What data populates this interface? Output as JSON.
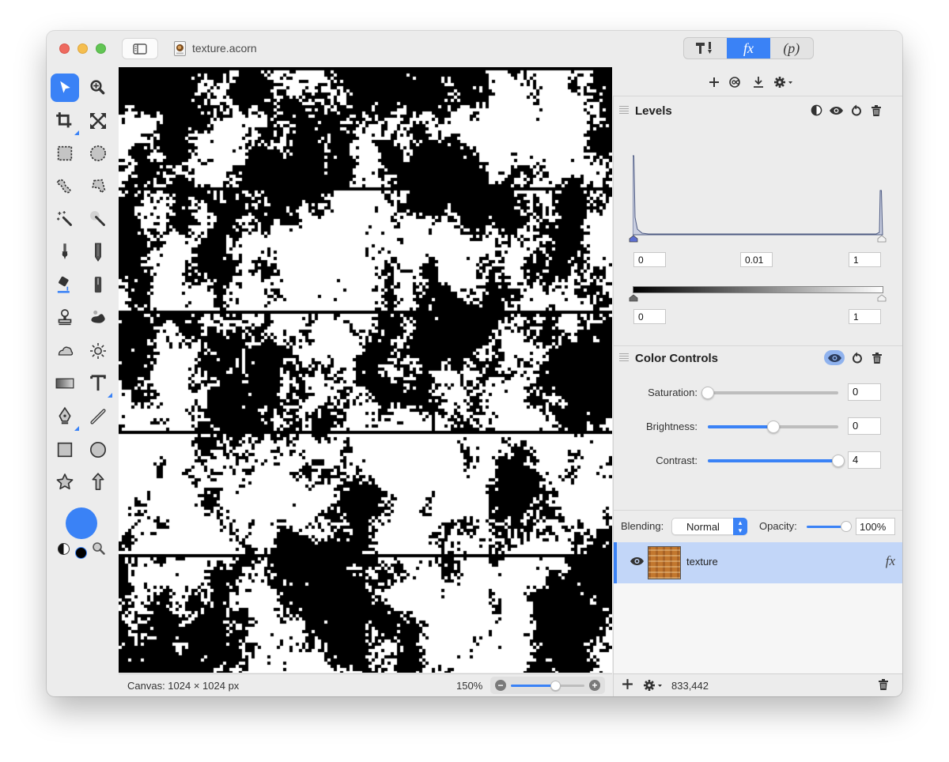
{
  "window": {
    "document_title": "texture.acorn",
    "traffic_lights": [
      "close",
      "minimize",
      "zoom"
    ]
  },
  "inspector_tabs": [
    {
      "id": "tools",
      "icon": "hammer-brush-icon",
      "label": "",
      "active": false
    },
    {
      "id": "effects",
      "icon": "fx-icon",
      "label": "fx",
      "active": true
    },
    {
      "id": "properties",
      "icon": "p-icon",
      "label": "(p)",
      "active": false
    }
  ],
  "inspector_toolbar": [
    "plus-icon",
    "filter-icon",
    "download-icon",
    "gear-menu-icon"
  ],
  "tools": [
    {
      "name": "select-tool",
      "active": true
    },
    {
      "name": "zoom-tool"
    },
    {
      "name": "crop-tool",
      "has_submenu": true
    },
    {
      "name": "transform-tool"
    },
    {
      "name": "rect-marquee-tool"
    },
    {
      "name": "ellipse-marquee-tool"
    },
    {
      "name": "lasso-tool"
    },
    {
      "name": "polygon-lasso-tool"
    },
    {
      "name": "magic-wand-tool"
    },
    {
      "name": "instant-alpha-tool"
    },
    {
      "name": "brush-tool"
    },
    {
      "name": "pencil-tool"
    },
    {
      "name": "paint-bucket-tool"
    },
    {
      "name": "eraser-tool"
    },
    {
      "name": "clone-stamp-tool"
    },
    {
      "name": "smudge-tool"
    },
    {
      "name": "burn-tool"
    },
    {
      "name": "dodge-tool"
    },
    {
      "name": "gradient-tool"
    },
    {
      "name": "text-tool",
      "has_submenu": true
    },
    {
      "name": "pen-tool",
      "has_submenu": true
    },
    {
      "name": "line-tool"
    },
    {
      "name": "rectangle-shape-tool"
    },
    {
      "name": "oval-shape-tool"
    },
    {
      "name": "star-tool"
    },
    {
      "name": "arrow-tool"
    }
  ],
  "colors": {
    "accent": "#3a82f6",
    "foreground_swatch": "#3a82f6",
    "background_swatch": "#000000"
  },
  "filters": {
    "levels": {
      "title": "Levels",
      "input_black": "0",
      "input_gamma": "0.01",
      "input_white": "1",
      "output_black": "0",
      "output_white": "1"
    },
    "color_controls": {
      "title": "Color Controls",
      "enabled_highlight": true,
      "saturation": {
        "label": "Saturation:",
        "value": "0",
        "fraction": 0.0
      },
      "brightness": {
        "label": "Brightness:",
        "value": "0",
        "fraction": 0.5
      },
      "contrast": {
        "label": "Contrast:",
        "value": "4",
        "fraction": 1.0
      }
    }
  },
  "layer_options": {
    "blending_label": "Blending:",
    "blending_value": "Normal",
    "opacity_label": "Opacity:",
    "opacity_value": "100%",
    "opacity_fraction": 1.0
  },
  "layers": [
    {
      "name": "texture",
      "visible": true,
      "selected": true,
      "has_effects": true,
      "fx_label": "fx"
    }
  ],
  "status": {
    "canvas_size": "Canvas: 1024 × 1024 px",
    "zoom": "150%",
    "zoom_fraction": 0.6,
    "coordinates": "833,442"
  }
}
